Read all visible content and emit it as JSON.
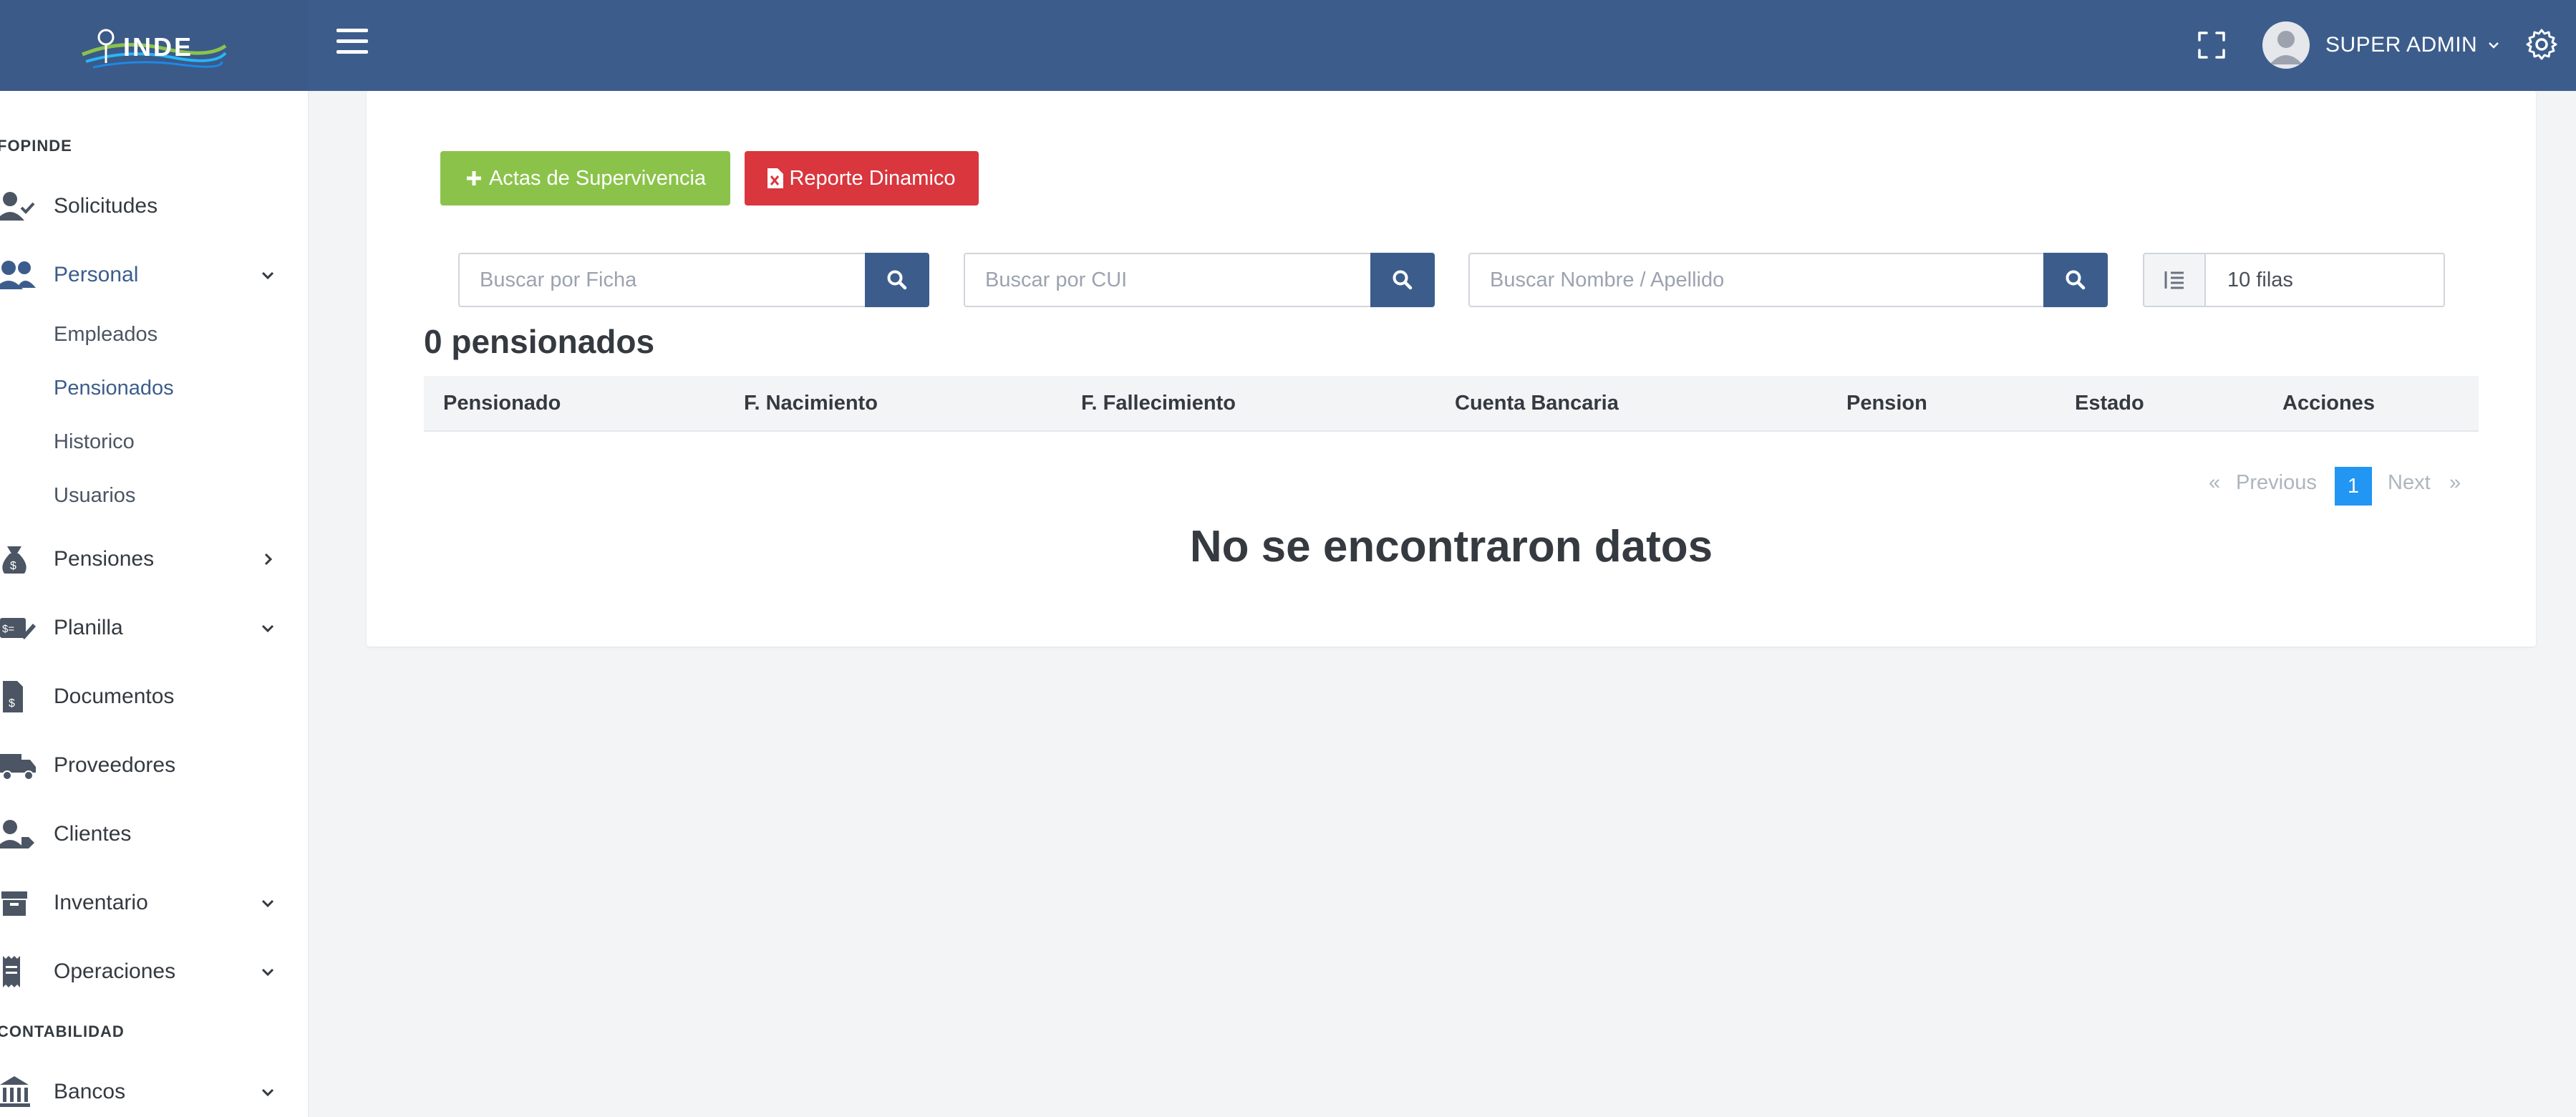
{
  "brand": {
    "logo_text": "INDE"
  },
  "header": {
    "user_name": "SUPER ADMIN"
  },
  "sidebar": {
    "section1": "FOPINDE",
    "items": [
      {
        "label": "Solicitudes"
      },
      {
        "label": "Personal"
      },
      {
        "label": "Pensiones"
      },
      {
        "label": "Planilla"
      },
      {
        "label": "Documentos"
      },
      {
        "label": "Proveedores"
      },
      {
        "label": "Clientes"
      },
      {
        "label": "Inventario"
      },
      {
        "label": "Operaciones"
      },
      {
        "label": "Bancos"
      }
    ],
    "sub_items": [
      {
        "label": "Empleados"
      },
      {
        "label": "Pensionados"
      },
      {
        "label": "Historico"
      },
      {
        "label": "Usuarios"
      }
    ],
    "section2": "CONTABILIDAD"
  },
  "actions": {
    "actas_label": "Actas de Supervivencia",
    "reporte_label": "Reporte Dinamico"
  },
  "filters": {
    "ficha_placeholder": "Buscar por Ficha",
    "cui_placeholder": "Buscar por CUI",
    "nombre_placeholder": "Buscar Nombre / Apellido",
    "rows_value": "10 filas"
  },
  "table": {
    "title": "0 pensionados",
    "columns": [
      "Pensionado",
      "F. Nacimiento",
      "F. Fallecimiento",
      "Cuenta Bancaria",
      "Pension",
      "Estado",
      "Acciones"
    ],
    "empty_message": "No se encontraron datos"
  },
  "pagination": {
    "first": "«",
    "previous": "Previous",
    "current": "1",
    "next": "Next",
    "last": "»"
  },
  "colors": {
    "header_bg": "#3c5d8c",
    "green_button": "#8bc34a",
    "red_button": "#d9363e",
    "active_page": "#2196f3"
  }
}
